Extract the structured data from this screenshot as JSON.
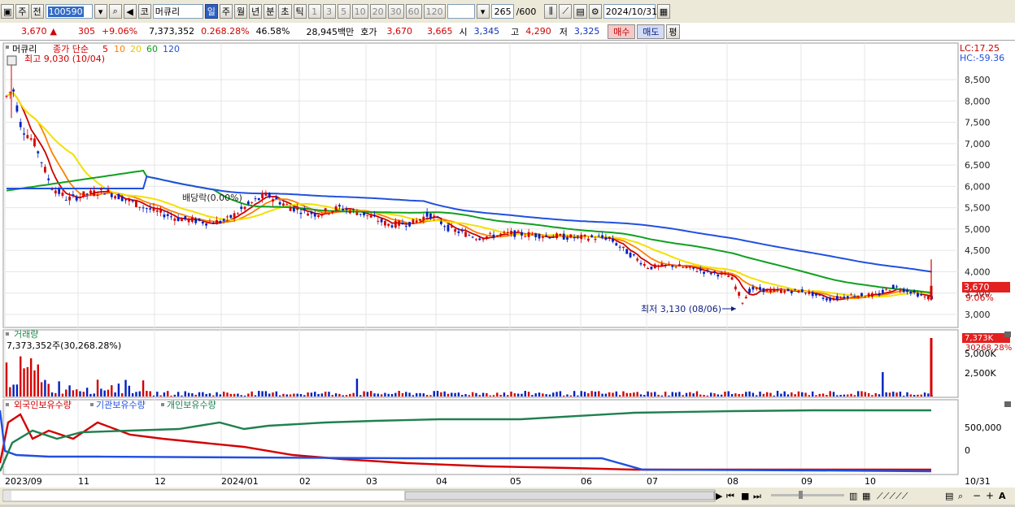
{
  "toolbar": {
    "type_button": "주",
    "prev_button": "전",
    "code": "100590",
    "stock_name_prefix": "코",
    "stock_name": "머큐리",
    "periods": [
      "일",
      "주",
      "월",
      "년",
      "분",
      "초",
      "틱"
    ],
    "active_period": "일",
    "intervals": [
      "1",
      "3",
      "5",
      "10",
      "20",
      "30",
      "60",
      "120"
    ],
    "count": "265",
    "count_total": "/600",
    "date": "2024/10/31"
  },
  "quote": {
    "price": "3,670",
    "arrow": "▲",
    "change": "305",
    "change_pct": "+9.06%",
    "volume": "7,373,352",
    "vol_ratio": "0.268.28%",
    "turnover_pct": "46.58%",
    "amount": "28,945백만",
    "hoga_label": "호가",
    "hoga_ask": "3,670",
    "hoga_bid": "3,665",
    "open_label": "시",
    "open": "3,345",
    "high_label": "고",
    "high": "4,290",
    "low_label": "저",
    "low": "3,325",
    "buy_button": "매수",
    "sell_button": "매도",
    "eval_button": "평"
  },
  "price_panel": {
    "legend_stock": "머큐리",
    "legend_ma_label": "종가 단순",
    "ma": [
      {
        "period": "5",
        "color": "#cc0000"
      },
      {
        "period": "10",
        "color": "#ff8000"
      },
      {
        "period": "20",
        "color": "#e6c800"
      },
      {
        "period": "60",
        "color": "#10a020"
      },
      {
        "period": "120",
        "color": "#2050e0"
      }
    ],
    "max_note": "최고 9,030 (10/04)",
    "min_note": "최저 3,130 (08/06)",
    "dividend_note": "배당락(0.00%)",
    "lc": "LC:17.25",
    "hc": "HC:-59.36",
    "y_ticks": [
      "8,500",
      "8,000",
      "7,500",
      "7,000",
      "6,500",
      "6,000",
      "5,500",
      "5,000",
      "4,500",
      "4,000",
      "3,500",
      "3,000"
    ],
    "current_price_label": "3,670",
    "current_change_label": "9.06%",
    "colors": {
      "up": "#d40000",
      "down": "#0020c0",
      "ma5": "#cc0000",
      "ma10": "#ff8000",
      "ma20": "#f2e000",
      "ma60": "#10a020",
      "ma120": "#2050e0"
    }
  },
  "volume_panel": {
    "title": "거래량",
    "summary": "7,373,352주(30,268.28%)",
    "y_ticks": [
      "5,000K",
      "2,500K"
    ],
    "current_label": "7,373K",
    "ratio_label": "30268.28%"
  },
  "holding_panel": {
    "series": [
      {
        "name": "외국인보유수량",
        "color": "#d40000"
      },
      {
        "name": "기관보유수량",
        "color": "#2050e0"
      },
      {
        "name": "개인보유수량",
        "color": "#208050"
      }
    ],
    "y_ticks": [
      "500,000",
      "0"
    ]
  },
  "x_axis": [
    "2023/09",
    "11",
    "12",
    "2024/01",
    "02",
    "03",
    "04",
    "05",
    "06",
    "07",
    "08",
    "09",
    "10",
    "10/31"
  ]
}
